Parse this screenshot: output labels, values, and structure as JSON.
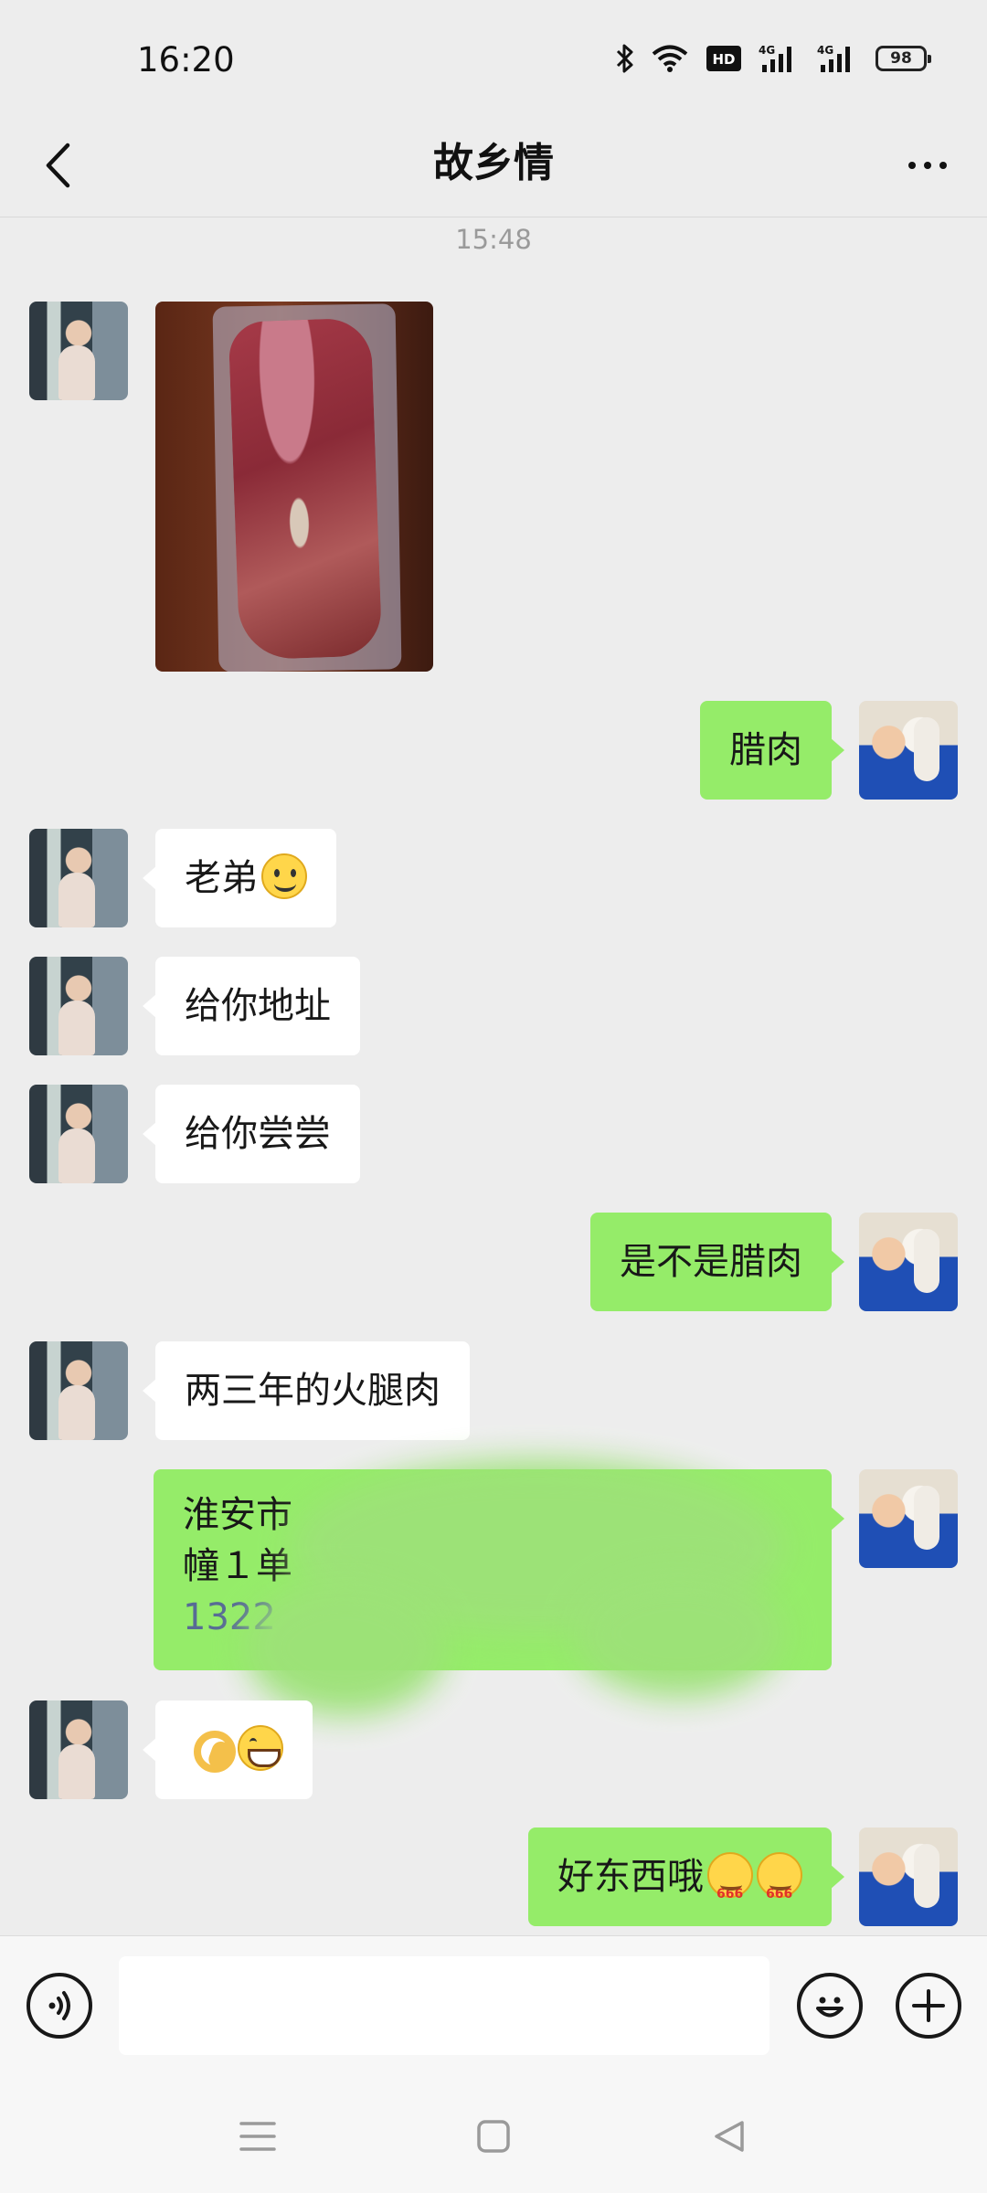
{
  "status_bar": {
    "time": "16:20",
    "battery": "98",
    "icons": [
      "bluetooth-icon",
      "wifi-icon",
      "hd-icon",
      "signal-4g-icon",
      "signal-4g-icon",
      "battery-icon"
    ]
  },
  "header": {
    "title": "故乡情",
    "back_icon": "chevron-left-icon",
    "more_icon": "more-dots-icon"
  },
  "chat": {
    "timestamp": "15:48",
    "messages": [
      {
        "from": "friend",
        "type": "image",
        "description_icon": "photo"
      },
      {
        "from": "me",
        "text": "腊肉"
      },
      {
        "from": "friend",
        "text": "老弟",
        "emoji": "smile"
      },
      {
        "from": "friend",
        "text": "给你地址"
      },
      {
        "from": "friend",
        "text": "给你尝尝"
      },
      {
        "from": "me",
        "text": "是不是腊肉"
      },
      {
        "from": "friend",
        "text": "两三年的火腿肉"
      },
      {
        "from": "me",
        "type": "address",
        "line1": "淮安市",
        "line2": "幢１单",
        "phone": "1322"
      },
      {
        "from": "friend",
        "text": "",
        "emoji": "ok-hand grin"
      },
      {
        "from": "me",
        "text": "好东西哦",
        "emoji": "666 666"
      }
    ]
  },
  "input_bar": {
    "placeholder": "",
    "voice_icon": "voice-icon",
    "emoji_icon": "emoji-icon",
    "plus_icon": "plus-icon"
  },
  "system_nav": {
    "icons": [
      "menu-icon",
      "home-icon",
      "back-triangle-icon"
    ]
  },
  "colors": {
    "background": "#ededed",
    "bubble_out": "#95ec69",
    "bubble_in": "#ffffff",
    "phone_link": "#576b95"
  }
}
